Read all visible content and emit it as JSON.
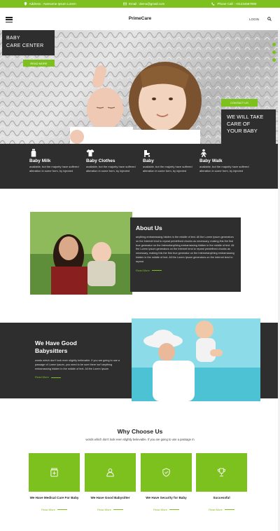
{
  "topbar": {
    "address": "Address : Awesome Ipsum Lorem",
    "email": "Email : demo@gmail.com",
    "phone": "Phone Call : +01234567890"
  },
  "nav": {
    "brand": "PrimeCare",
    "login": "LOGIN"
  },
  "hero": {
    "title_line1": "BABY",
    "title_line2": "CARE CENTER",
    "read_more": "READ MORE",
    "contact": "CONTACT US",
    "tag_line1": "WE WILL TAKE",
    "tag_line2": "CARE OF",
    "tag_line3": "YOUR BABY"
  },
  "features": [
    {
      "title": "Baby Milk",
      "desc": "available, but the majority have suffered alteration in some form, by injected",
      "icon": "bottle-icon"
    },
    {
      "title": "Baby Clothes",
      "desc": "available, but the majority have suffered alteration in some form, by injected",
      "icon": "shirt-icon"
    },
    {
      "title": "Baby",
      "desc": "available, but the majority have suffered alteration in some form, by injected",
      "icon": "stroller-icon"
    },
    {
      "title": "Baby Walk",
      "desc": "available, but the majority have suffered alteration in some form, by injected",
      "icon": "walking-baby-icon"
    }
  ],
  "about": {
    "title": "About Us",
    "text": "anything embarrassing hidden in the middle of text. All the Lorem Ipsum generators on the Internet tend to repeat predefined chunks as necessary, making this the first true generator on the Internetanything embarrassing hidden in the middle of text. All the Lorem Ipsum generators on the Internet tend to repeat predefined chunks as necessary, making this the first true generator on the Internetanything embarrassing hidden in the middle of text. All the Lorem Ipsum generators on the Internet tend to repeat",
    "read_more": "Read More"
  },
  "babysitters": {
    "title_line1": "We Have Good",
    "title_line2": "Babysitters",
    "text": "words which don't look even slightly believable. If you are going to use a passage of Lorem Ipsum, you need to be sure there isn't anything embarrassing hidden in the middle of text. All the Lorem Ipsum",
    "read_more": "Read More"
  },
  "why": {
    "title": "Why Choose Us",
    "subtitle": "words which don't look even slightly believable. If you are going to use a passage m",
    "cards": [
      {
        "title": "We Have Medical Care For Baby",
        "read_more": "Read More",
        "icon": "medicine-icon"
      },
      {
        "title": "We Have Good Babysitter",
        "read_more": "Read More",
        "icon": "babysitter-icon"
      },
      {
        "title": "We Have Security for Baby",
        "read_more": "Read More",
        "icon": "shield-icon"
      },
      {
        "title": "Successful",
        "read_more": "Read More",
        "icon": "trophy-icon"
      }
    ]
  },
  "colors": {
    "accent": "#7dc11f",
    "dark": "#2e2e2e"
  }
}
